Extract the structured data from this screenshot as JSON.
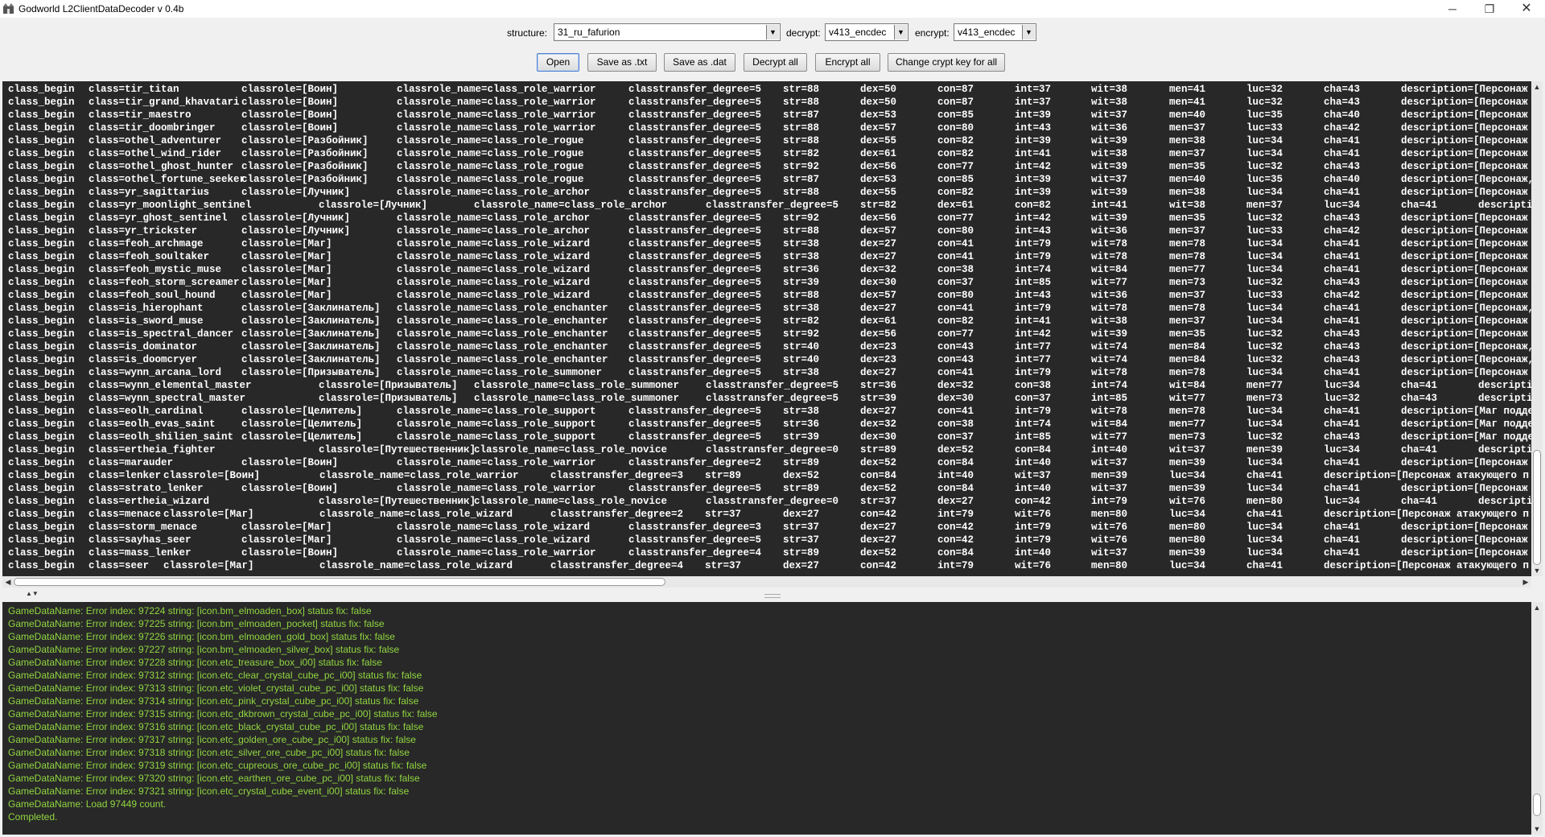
{
  "window": {
    "title": "Godworld L2ClientDataDecoder v 0.4b",
    "min_glyph": "─",
    "max_glyph": "❐",
    "close_glyph": "✕"
  },
  "toolbar": {
    "structure_label": "structure:",
    "structure_value": "31_ru_fafurion",
    "decrypt_label": "decrypt:",
    "decrypt_value": "v413_encdec",
    "encrypt_label": "encrypt:",
    "encrypt_value": "v413_encdec",
    "buttons": [
      "Open",
      "Save as .txt",
      "Save as .dat",
      "Decrypt all",
      "Encrypt all",
      "Change crypt key for all"
    ]
  },
  "data_rows": [
    [
      "class_begin",
      "class=tir_titan",
      "classrole=[Воин]",
      "classrole_name=class_role_warrior",
      "classtransfer_degree=5",
      "str=88",
      "dex=50",
      "con=87",
      "int=37",
      "wit=38",
      "men=41",
      "luc=32",
      "cha=43",
      "description=[Персонаж"
    ],
    [
      "class_begin",
      "class=tir_grand_khavatari",
      "classrole=[Воин]",
      "classrole_name=class_role_warrior",
      "classtransfer_degree=5",
      "str=88",
      "dex=50",
      "con=87",
      "int=37",
      "wit=38",
      "men=41",
      "luc=32",
      "cha=43",
      "description=[Персонаж"
    ],
    [
      "class_begin",
      "class=tir_maestro",
      "classrole=[Воин]",
      "classrole_name=class_role_warrior",
      "classtransfer_degree=5",
      "str=87",
      "dex=53",
      "con=85",
      "int=39",
      "wit=37",
      "men=40",
      "luc=35",
      "cha=40",
      "description=[Персонаж"
    ],
    [
      "class_begin",
      "class=tir_doombringer",
      "classrole=[Воин]",
      "classrole_name=class_role_warrior",
      "classtransfer_degree=5",
      "str=88",
      "dex=57",
      "con=80",
      "int=43",
      "wit=36",
      "men=37",
      "luc=33",
      "cha=42",
      "description=[Персонаж"
    ],
    [
      "class_begin",
      "class=othel_adventurer",
      "classrole=[Разбойник]",
      "classrole_name=class_role_rogue",
      "classtransfer_degree=5",
      "str=88",
      "dex=55",
      "con=82",
      "int=39",
      "wit=39",
      "men=38",
      "luc=34",
      "cha=41",
      "description=[Персонаж"
    ],
    [
      "class_begin",
      "class=othel_wind_rider",
      "classrole=[Разбойник]",
      "classrole_name=class_role_rogue",
      "classtransfer_degree=5",
      "str=82",
      "dex=61",
      "con=82",
      "int=41",
      "wit=38",
      "men=37",
      "luc=34",
      "cha=41",
      "description=[Персонаж"
    ],
    [
      "class_begin",
      "class=othel_ghost_hunter",
      "classrole=[Разбойник]",
      "classrole_name=class_role_rogue",
      "classtransfer_degree=5",
      "str=92",
      "dex=56",
      "con=77",
      "int=42",
      "wit=39",
      "men=35",
      "luc=32",
      "cha=43",
      "description=[Персонаж"
    ],
    [
      "class_begin",
      "class=othel_fortune_seeker",
      "classrole=[Разбойник]",
      "classrole_name=class_role_rogue",
      "classtransfer_degree=5",
      "str=87",
      "dex=53",
      "con=85",
      "int=39",
      "wit=37",
      "men=40",
      "luc=35",
      "cha=40",
      "description=[Персонаж,"
    ],
    [
      "class_begin",
      "class=yr_sagittarius",
      "classrole=[Лучник]",
      "classrole_name=class_role_archor",
      "classtransfer_degree=5",
      "str=88",
      "dex=55",
      "con=82",
      "int=39",
      "wit=39",
      "men=38",
      "luc=34",
      "cha=41",
      "description=[Персонаж"
    ],
    [
      "class_begin",
      "class=yr_moonlight_sentinel",
      "classrole=[Лучник]",
      "classrole_name=class_role_archor",
      "classtransfer_degree=5",
      "str=82",
      "dex=61",
      "con=82",
      "int=41",
      "wit=38",
      "men=37",
      "luc=34",
      "cha=41",
      "descriptio"
    ],
    [
      "class_begin",
      "class=yr_ghost_sentinel",
      "classrole=[Лучник]",
      "classrole_name=class_role_archor",
      "classtransfer_degree=5",
      "str=92",
      "dex=56",
      "con=77",
      "int=42",
      "wit=39",
      "men=35",
      "luc=32",
      "cha=43",
      "description=[Персонаж"
    ],
    [
      "class_begin",
      "class=yr_trickster",
      "classrole=[Лучник]",
      "classrole_name=class_role_archor",
      "classtransfer_degree=5",
      "str=88",
      "dex=57",
      "con=80",
      "int=43",
      "wit=36",
      "men=37",
      "luc=33",
      "cha=42",
      "description=[Персонаж"
    ],
    [
      "class_begin",
      "class=feoh_archmage",
      "classrole=[Маг]",
      "classrole_name=class_role_wizard",
      "classtransfer_degree=5",
      "str=38",
      "dex=27",
      "con=41",
      "int=79",
      "wit=78",
      "men=78",
      "luc=34",
      "cha=41",
      "description=[Персонаж"
    ],
    [
      "class_begin",
      "class=feoh_soultaker",
      "classrole=[Маг]",
      "classrole_name=class_role_wizard",
      "classtransfer_degree=5",
      "str=38",
      "dex=27",
      "con=41",
      "int=79",
      "wit=78",
      "men=78",
      "luc=34",
      "cha=41",
      "description=[Персонаж"
    ],
    [
      "class_begin",
      "class=feoh_mystic_muse",
      "classrole=[Маг]",
      "classrole_name=class_role_wizard",
      "classtransfer_degree=5",
      "str=36",
      "dex=32",
      "con=38",
      "int=74",
      "wit=84",
      "men=77",
      "luc=34",
      "cha=41",
      "description=[Персонаж"
    ],
    [
      "class_begin",
      "class=feoh_storm_screamer",
      "classrole=[Маг]",
      "classrole_name=class_role_wizard",
      "classtransfer_degree=5",
      "str=39",
      "dex=30",
      "con=37",
      "int=85",
      "wit=77",
      "men=73",
      "luc=32",
      "cha=43",
      "description=[Персонаж"
    ],
    [
      "class_begin",
      "class=feoh_soul_hound",
      "classrole=[Маг]",
      "classrole_name=class_role_wizard",
      "classtransfer_degree=5",
      "str=88",
      "dex=57",
      "con=80",
      "int=43",
      "wit=36",
      "men=37",
      "luc=33",
      "cha=42",
      "description=[Персонаж"
    ],
    [
      "class_begin",
      "class=is_hierophant",
      "classrole=[Заклинатель]",
      "classrole_name=class_role_enchanter",
      "classtransfer_degree=5",
      "str=38",
      "dex=27",
      "con=41",
      "int=79",
      "wit=78",
      "men=78",
      "luc=34",
      "cha=41",
      "description=[Персонаж,"
    ],
    [
      "class_begin",
      "class=is_sword_muse",
      "classrole=[Заклинатель]",
      "classrole_name=class_role_enchanter",
      "classtransfer_degree=5",
      "str=82",
      "dex=61",
      "con=82",
      "int=41",
      "wit=38",
      "men=37",
      "luc=34",
      "cha=41",
      "description=[Персонаж"
    ],
    [
      "class_begin",
      "class=is_spectral_dancer",
      "classrole=[Заклинатель]",
      "classrole_name=class_role_enchanter",
      "classtransfer_degree=5",
      "str=92",
      "dex=56",
      "con=77",
      "int=42",
      "wit=39",
      "men=35",
      "luc=32",
      "cha=43",
      "description=[Персонаж"
    ],
    [
      "class_begin",
      "class=is_dominator",
      "classrole=[Заклинатель]",
      "classrole_name=class_role_enchanter",
      "classtransfer_degree=5",
      "str=40",
      "dex=23",
      "con=43",
      "int=77",
      "wit=74",
      "men=84",
      "luc=32",
      "cha=43",
      "description=[Персонаж,"
    ],
    [
      "class_begin",
      "class=is_doomcryer",
      "classrole=[Заклинатель]",
      "classrole_name=class_role_enchanter",
      "classtransfer_degree=5",
      "str=40",
      "dex=23",
      "con=43",
      "int=77",
      "wit=74",
      "men=84",
      "luc=32",
      "cha=43",
      "description=[Персонаж,"
    ],
    [
      "class_begin",
      "class=wynn_arcana_lord",
      "classrole=[Призыватель]",
      "classrole_name=class_role_summoner",
      "classtransfer_degree=5",
      "str=38",
      "dex=27",
      "con=41",
      "int=79",
      "wit=78",
      "men=78",
      "luc=34",
      "cha=41",
      "description=[Персонаж"
    ],
    [
      "class_begin",
      "class=wynn_elemental_master",
      "classrole=[Призыватель]",
      "classrole_name=class_role_summoner",
      "classtransfer_degree=5",
      "str=36",
      "dex=32",
      "con=38",
      "int=74",
      "wit=84",
      "men=77",
      "luc=34",
      "cha=41",
      "descriptio"
    ],
    [
      "class_begin",
      "class=wynn_spectral_master",
      "classrole=[Призыватель]",
      "classrole_name=class_role_summoner",
      "classtransfer_degree=5",
      "str=39",
      "dex=30",
      "con=37",
      "int=85",
      "wit=77",
      "men=73",
      "luc=32",
      "cha=43",
      "descriptio"
    ],
    [
      "class_begin",
      "class=eolh_cardinal",
      "classrole=[Целитель]",
      "classrole_name=class_role_support",
      "classtransfer_degree=5",
      "str=38",
      "dex=27",
      "con=41",
      "int=79",
      "wit=78",
      "men=78",
      "luc=34",
      "cha=41",
      "description=[Маг поддер"
    ],
    [
      "class_begin",
      "class=eolh_evas_saint",
      "classrole=[Целитель]",
      "classrole_name=class_role_support",
      "classtransfer_degree=5",
      "str=36",
      "dex=32",
      "con=38",
      "int=74",
      "wit=84",
      "men=77",
      "luc=34",
      "cha=41",
      "description=[Маг поддер"
    ],
    [
      "class_begin",
      "class=eolh_shilien_saint",
      "classrole=[Целитель]",
      "classrole_name=class_role_support",
      "classtransfer_degree=5",
      "str=39",
      "dex=30",
      "con=37",
      "int=85",
      "wit=77",
      "men=73",
      "luc=32",
      "cha=43",
      "description=[Маг поддер"
    ],
    [
      "class_begin",
      "class=ertheia_fighter",
      "classrole=[Путешественник]",
      "classrole_name=class_role_novice",
      "classtransfer_degree=0",
      "str=89",
      "dex=52",
      "con=84",
      "int=40",
      "wit=37",
      "men=39",
      "luc=34",
      "cha=41",
      "descriptio"
    ],
    [
      "class_begin",
      "class=marauder",
      "classrole=[Воин]",
      "classrole_name=class_role_warrior",
      "classtransfer_degree=2",
      "str=89",
      "dex=52",
      "con=84",
      "int=40",
      "wit=37",
      "men=39",
      "luc=34",
      "cha=41",
      "description=[Персонаж"
    ],
    [
      "class_begin",
      "class=lenker",
      "classrole=[Воин]",
      "classrole_name=class_role_warrior",
      "classtransfer_degree=3",
      "str=89",
      "dex=52",
      "con=84",
      "int=40",
      "wit=37",
      "men=39",
      "luc=34",
      "cha=41",
      "description=[Персонаж атакующего п"
    ],
    [
      "class_begin",
      "class=strato_lenker",
      "classrole=[Воин]",
      "classrole_name=class_role_warrior",
      "classtransfer_degree=5",
      "str=89",
      "dex=52",
      "con=84",
      "int=40",
      "wit=37",
      "men=39",
      "luc=34",
      "cha=41",
      "description=[Персонаж"
    ],
    [
      "class_begin",
      "class=ertheia_wizard",
      "classrole=[Путешественник]",
      "classrole_name=class_role_novice",
      "classtransfer_degree=0",
      "str=37",
      "dex=27",
      "con=42",
      "int=79",
      "wit=76",
      "men=80",
      "luc=34",
      "cha=41",
      "descriptio"
    ],
    [
      "class_begin",
      "class=menace",
      "classrole=[Маг]",
      "classrole_name=class_role_wizard",
      "classtransfer_degree=2",
      "str=37",
      "dex=27",
      "con=42",
      "int=79",
      "wit=76",
      "men=80",
      "luc=34",
      "cha=41",
      "description=[Персонаж атакующего п"
    ],
    [
      "class_begin",
      "class=storm_menace",
      "classrole=[Маг]",
      "classrole_name=class_role_wizard",
      "classtransfer_degree=3",
      "str=37",
      "dex=27",
      "con=42",
      "int=79",
      "wit=76",
      "men=80",
      "luc=34",
      "cha=41",
      "description=[Персонаж"
    ],
    [
      "class_begin",
      "class=sayhas_seer",
      "classrole=[Маг]",
      "classrole_name=class_role_wizard",
      "classtransfer_degree=5",
      "str=37",
      "dex=27",
      "con=42",
      "int=79",
      "wit=76",
      "men=80",
      "luc=34",
      "cha=41",
      "description=[Персонаж"
    ],
    [
      "class_begin",
      "class=mass_lenker",
      "classrole=[Воин]",
      "classrole_name=class_role_warrior",
      "classtransfer_degree=4",
      "str=89",
      "dex=52",
      "con=84",
      "int=40",
      "wit=37",
      "men=39",
      "luc=34",
      "cha=41",
      "description=[Персонаж"
    ],
    [
      "class_begin",
      "class=seer",
      "classrole=[Маг]",
      "classrole_name=class_role_wizard",
      "classtransfer_degree=4",
      "str=37",
      "dex=27",
      "con=42",
      "int=79",
      "wit=76",
      "men=80",
      "luc=34",
      "cha=41",
      "description=[Персонаж атакующего п"
    ]
  ],
  "log_lines": [
    "GameDataName: Error index: 97224 string: [icon.bm_elmoaden_box] status fix: false",
    "GameDataName: Error index: 97225 string: [icon.bm_elmoaden_pocket] status fix: false",
    "GameDataName: Error index: 97226 string: [icon.bm_elmoaden_gold_box] status fix: false",
    "GameDataName: Error index: 97227 string: [icon.bm_elmoaden_silver_box] status fix: false",
    "GameDataName: Error index: 97228 string: [icon.etc_treasure_box_i00] status fix: false",
    "GameDataName: Error index: 97312 string: [icon.etc_clear_crystal_cube_pc_i00] status fix: false",
    "GameDataName: Error index: 97313 string: [icon.etc_violet_crystal_cube_pc_i00] status fix: false",
    "GameDataName: Error index: 97314 string: [icon.etc_pink_crystal_cube_pc_i00] status fix: false",
    "GameDataName: Error index: 97315 string: [icon.etc_dkbrown_crystal_cube_pc_i00] status fix: false",
    "GameDataName: Error index: 97316 string: [icon.etc_black_crystal_cube_pc_i00] status fix: false",
    "GameDataName: Error index: 97317 string: [icon.etc_golden_ore_cube_pc_i00] status fix: false",
    "GameDataName: Error index: 97318 string: [icon.etc_silver_ore_cube_pc_i00] status fix: false",
    "GameDataName: Error index: 97319 string: [icon.etc_cupreous_ore_cube_pc_i00] status fix: false",
    "GameDataName: Error index: 97320 string: [icon.etc_earthen_ore_cube_pc_i00] status fix: false",
    "GameDataName: Error index: 97321 string: [icon.etc_crystal_cube_event_i00] status fix: false",
    "GameDataName: Load 97449 count.",
    "Completed."
  ],
  "colors": {
    "data_bg": "#282828",
    "data_text": "#ffffff",
    "log_text": "#90d640"
  }
}
